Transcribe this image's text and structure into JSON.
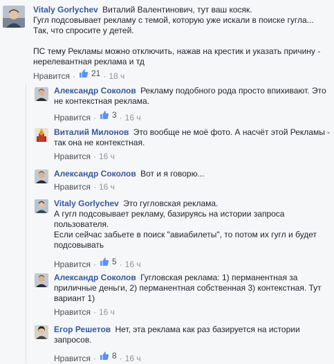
{
  "comments": [
    {
      "author": "Vitaly Gorlychev",
      "text": "Виталий Валентинович, тут ваш косяк.\nГугл подсовывает рекламу с темой, которую уже искали в поиске гугла...\nТак, что спросите у детей.\n\nПС тему Рекламы можно отключить, нажав на крестик и указать причину - нерелевантная реклама и тд",
      "like_label": "Нравится",
      "likes": "21",
      "time": "18 ч",
      "avatar": "person-photo-icon"
    }
  ],
  "replies": [
    {
      "author": "Александр Соколов",
      "text": "Рекламу подобного рода просто впихивают. Это не контекстная реклама.",
      "like_label": "Нравится",
      "likes": "3",
      "time": "16 ч",
      "avatar": "person-photo-icon"
    },
    {
      "author": "Виталий Милонов",
      "text": "Это вообще не моё фото. А насчёт этой Рекламы - так она не контекстная.",
      "like_label": "Нравится",
      "likes": "",
      "time": "16 ч",
      "avatar": "church-photo-icon"
    },
    {
      "author": "Александр Соколов",
      "text": "Вот и я говорю...",
      "like_label": "Нравится",
      "likes": "",
      "time": "16 ч",
      "avatar": "person-photo-icon"
    },
    {
      "author": "Vitaly Gorlychev",
      "text": "Это гугловская реклама.\nА гугл подсовывает рекламу, базируясь на истории запроса пользователя.\nЕсли сейчас забьете в поиск \"авиабилеты\", то потом их гугл и будет подсовывать",
      "like_label": "Нравится",
      "likes": "5",
      "time": "16 ч",
      "avatar": "person-photo-icon"
    },
    {
      "author": "Александр Соколов",
      "text": "Гугловская реклама: 1) перманентная за приличные деньги, 2) перманентная собственная 3) контекстная. Тут вариант 1)",
      "like_label": "Нравится",
      "likes": "",
      "time": "16 ч",
      "avatar": "person-photo-icon"
    },
    {
      "author": "Егор Решетов",
      "text": "Нет, эта реклама как раз базируется на истории запросов.",
      "like_label": "Нравится",
      "likes": "8",
      "time": "16 ч",
      "avatar": "person-photo-icon"
    }
  ],
  "colors": {
    "author": "#365899",
    "meta": "#90949c",
    "like_badge": "#5890ff"
  }
}
